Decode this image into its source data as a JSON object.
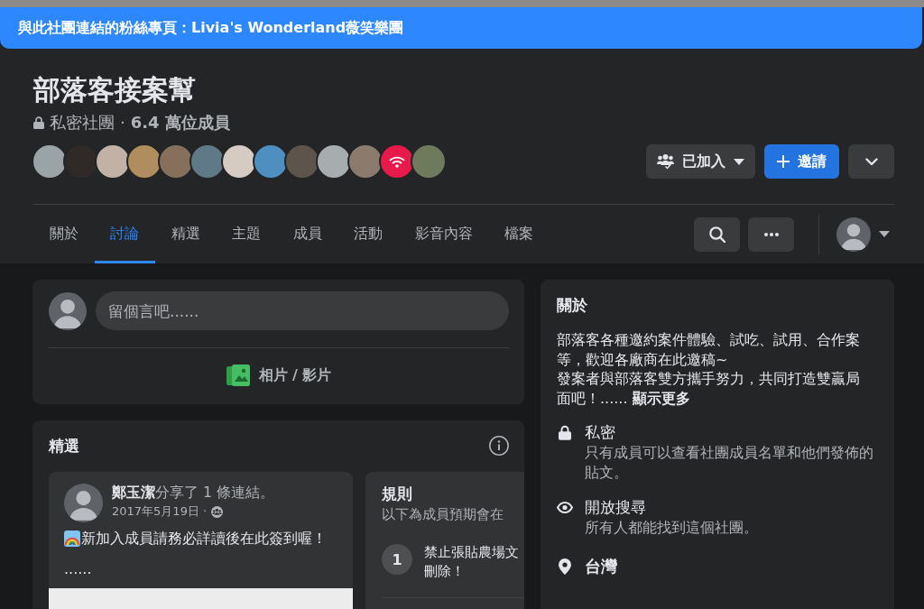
{
  "linked_page_banner": {
    "label": "與此社團連結的粉絲專頁：",
    "page_name": "Livia's Wonderland薇笑樂團"
  },
  "group": {
    "name": "部落客接案幫",
    "privacy": "私密社團",
    "separator": "·",
    "members": "6.4 萬位成員",
    "member_avatars": [
      {
        "kind": "photo"
      },
      {
        "kind": "photo"
      },
      {
        "kind": "photo"
      },
      {
        "kind": "photo"
      },
      {
        "kind": "photo"
      },
      {
        "kind": "photo"
      },
      {
        "kind": "photo"
      },
      {
        "kind": "photo"
      },
      {
        "kind": "photo"
      },
      {
        "kind": "photo"
      },
      {
        "kind": "photo"
      },
      {
        "kind": "logo"
      },
      {
        "kind": "photo"
      }
    ]
  },
  "actions": {
    "joined": "已加入",
    "invite": "邀請"
  },
  "tabs": [
    {
      "label": "關於",
      "selected": false
    },
    {
      "label": "討論",
      "selected": true
    },
    {
      "label": "精選",
      "selected": false
    },
    {
      "label": "主題",
      "selected": false
    },
    {
      "label": "成員",
      "selected": false
    },
    {
      "label": "活動",
      "selected": false
    },
    {
      "label": "影音內容",
      "selected": false
    },
    {
      "label": "檔案",
      "selected": false
    }
  ],
  "composer": {
    "placeholder": "留個言吧......",
    "media_button": "相片 / 影片"
  },
  "featured": {
    "title": "精選",
    "post": {
      "author": "鄭玉潔",
      "action": "分享了 1 條連結。",
      "date": "2017年5月19日 ·",
      "text": "新加入成員請務必詳讀後在此簽到喔！",
      "more": "......"
    },
    "rules": {
      "title": "規則",
      "subtitle": "以下為成員預期會在",
      "items": [
        {
          "number": "1",
          "text_lines": [
            "禁止張貼農場文",
            "刪除！"
          ]
        }
      ]
    }
  },
  "about": {
    "title": "關於",
    "description": [
      "部落客各種邀約案件體驗、試吃、試用、合作案等，歡迎各廠商在此邀稿~",
      "發案者與部落客雙方攜手努力，共同打造雙贏局面吧！......"
    ],
    "show_more": "顯示更多",
    "items": [
      {
        "kind": "privacy",
        "title": "私密",
        "text": "只有成員可以查看社團成員名單和他們發佈的貼文。"
      },
      {
        "kind": "visibility",
        "title": "開放搜尋",
        "text": "所有人都能找到這個社團。"
      },
      {
        "kind": "location",
        "title": "台灣"
      }
    ]
  }
}
